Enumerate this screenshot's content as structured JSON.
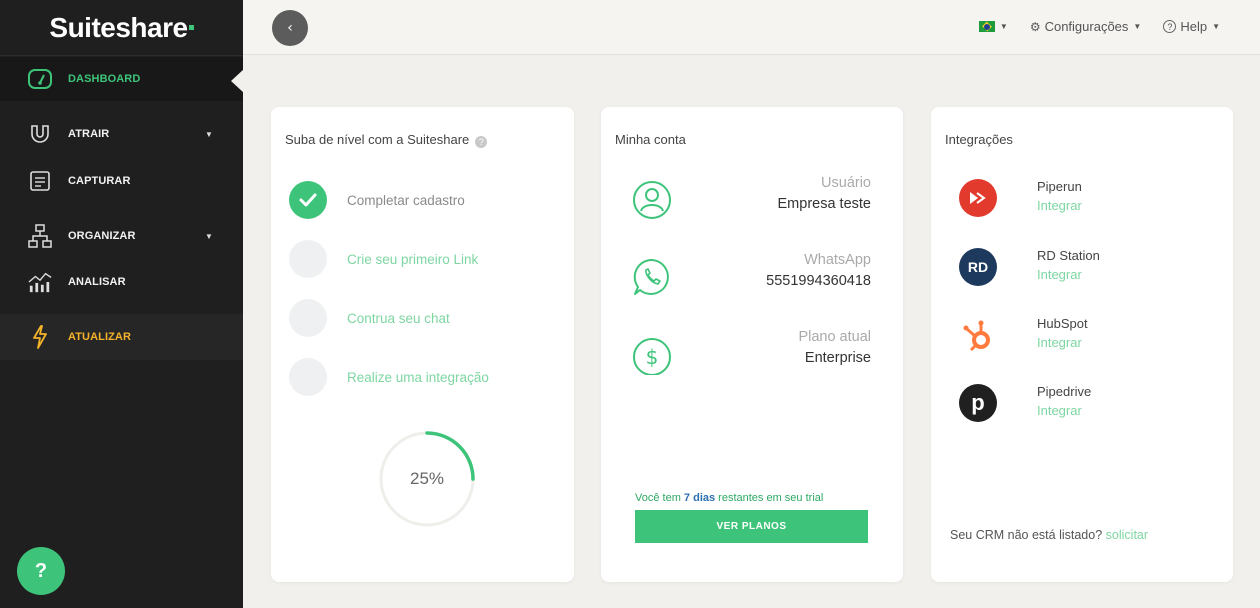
{
  "sidebar": {
    "brand": "Suiteshare",
    "items": [
      {
        "label": "DASHBOARD",
        "icon": "dashboard-gauge-icon",
        "active": true
      },
      {
        "label": "ATRAIR",
        "icon": "magnet-icon",
        "has_dropdown": true
      },
      {
        "label": "CAPTURAR",
        "icon": "capture-form-icon"
      },
      {
        "label": "ORGANIZAR",
        "icon": "org-chart-icon",
        "has_dropdown": true
      },
      {
        "label": "ANALISAR",
        "icon": "analytics-chart-icon"
      },
      {
        "label": "ATUALIZAR",
        "icon": "lightning-icon"
      }
    ],
    "help_fab": "?"
  },
  "topbar": {
    "language": "pt-BR",
    "settings_label": "Configurações",
    "help_label": "Help"
  },
  "onboarding": {
    "title": "Suba de nível com a Suiteshare",
    "steps": [
      {
        "label": "Completar cadastro",
        "done": true
      },
      {
        "label": "Crie seu primeiro Link",
        "done": false
      },
      {
        "label": "Contrua seu chat",
        "done": false
      },
      {
        "label": "Realize uma integração",
        "done": false
      }
    ],
    "progress_label": "25%",
    "progress_value": 0.25
  },
  "account": {
    "title": "Minha conta",
    "rows": [
      {
        "label": "Usuário",
        "value": "Empresa teste",
        "icon": "user-circle-icon"
      },
      {
        "label": "WhatsApp",
        "value": "5551994360418",
        "icon": "whatsapp-icon"
      },
      {
        "label": "Plano atual",
        "value": "Enterprise",
        "icon": "dollar-circle-icon"
      }
    ],
    "trial_prefix": "Você tem ",
    "trial_days": "7 dias",
    "trial_suffix": " restantes em seu trial",
    "cta_label": "VER PLANOS"
  },
  "integrations": {
    "title": "Integrações",
    "items": [
      {
        "name": "Piperun",
        "action": "Integrar",
        "logo_text": "",
        "color": "#e23b2e"
      },
      {
        "name": "RD Station",
        "action": "Integrar",
        "logo_text": "RD",
        "color": "#1d3a5e"
      },
      {
        "name": "HubSpot",
        "action": "Integrar",
        "logo_text": "",
        "color": "#ff7a3d"
      },
      {
        "name": "Pipedrive",
        "action": "Integrar",
        "logo_text": "p",
        "color": "#202020"
      }
    ],
    "footer_text": "Seu CRM não está listado?",
    "footer_link": "solicitar"
  },
  "colors": {
    "brand_green": "#3ec47a",
    "sidebar_bg": "#1f1f1f",
    "upgrade_yellow": "#f5b32a",
    "page_bg": "#f2f0ec"
  }
}
